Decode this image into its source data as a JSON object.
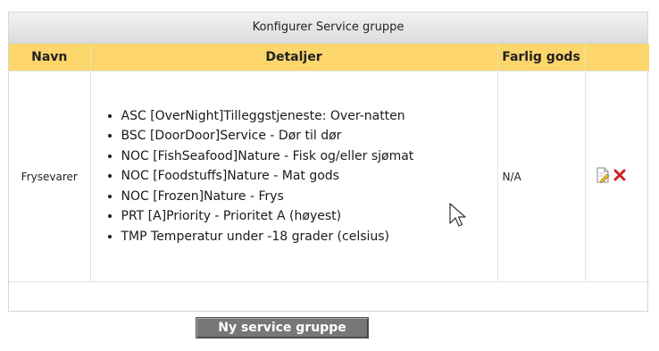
{
  "panel": {
    "title": "Konfigurer Service gruppe"
  },
  "table": {
    "headers": {
      "name": "Navn",
      "details": "Detaljer",
      "hazardous": "Farlig gods",
      "actions": ""
    },
    "rows": [
      {
        "name": "Frysevarer",
        "details": [
          "ASC [OverNight]Tilleggstjeneste: Over-natten",
          "BSC [DoorDoor]Service - Dør til dør",
          "NOC [FishSeafood]Nature - Fisk og/eller sjømat",
          "NOC [Foodstuffs]Nature - Mat gods",
          "NOC [Frozen]Nature - Frys",
          "PRT [A]Priority - Prioritet A (høyest)",
          "TMP Temperatur under -18 grader (celsius)"
        ],
        "hazardous": "N/A",
        "actions": [
          "edit-icon",
          "delete-icon"
        ]
      }
    ]
  },
  "buttons": {
    "new_group": "Ny service gruppe"
  },
  "colors": {
    "header_bg": "#fcd66b",
    "button_bg": "#777777",
    "delete": "#cc2222"
  }
}
